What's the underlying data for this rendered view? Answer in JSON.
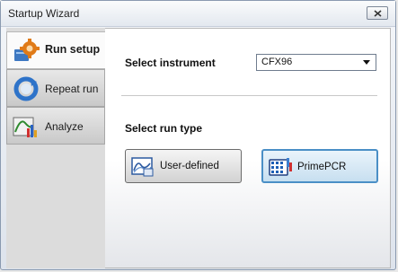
{
  "window": {
    "title": "Startup Wizard"
  },
  "sidebar": {
    "tabs": [
      {
        "label": "Run setup",
        "icon": "gear-icon",
        "active": true
      },
      {
        "label": "Repeat run",
        "icon": "repeat-icon",
        "active": false
      },
      {
        "label": "Analyze",
        "icon": "analyze-chart-icon",
        "active": false
      }
    ]
  },
  "main": {
    "instrument_label": "Select instrument",
    "instrument_value": "CFX96",
    "run_type_label": "Select run type",
    "buttons": {
      "user_defined": "User-defined",
      "primepcr": "PrimePCR"
    }
  },
  "colors": {
    "accent": "#4a8fc6",
    "tab_active_bg": "#fbfbfb",
    "sidebar_bg": "#dcdcdc"
  }
}
